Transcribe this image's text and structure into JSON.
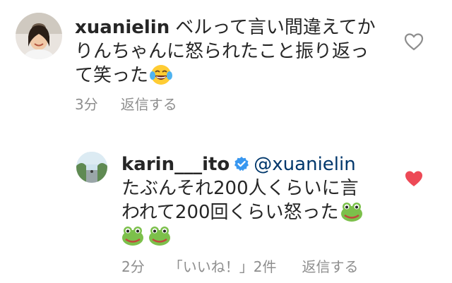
{
  "comments": [
    {
      "username": "xuanielin",
      "text": "ベルって言い間違えてかりんちゃんに怒られたこと振り返って笑った",
      "emoji": "joy-emoji",
      "time": "3分",
      "reply_label": "返信する",
      "liked": false
    },
    {
      "username": "karin___ito",
      "verified": true,
      "mention": "@xuanielin",
      "text": "たぶんそれ200人くらいに言われて200回くらい怒った",
      "emoji": "frog-emoji",
      "emoji_trailing_count": 3,
      "time": "2分",
      "likes_label": "「いいね！」2件",
      "reply_label": "返信する",
      "liked": true
    }
  ],
  "colors": {
    "text": "#262626",
    "secondary": "#8e8e8e",
    "link": "#00376b",
    "verified": "#3897f0",
    "heart_liked": "#ed4956",
    "heart_outline": "#8e8e8e"
  }
}
